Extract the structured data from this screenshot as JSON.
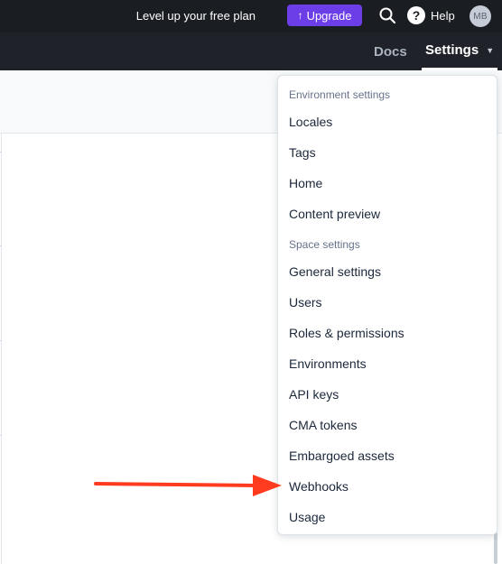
{
  "topbar": {
    "promo_text": "Level up your free plan",
    "upgrade_label": "Upgrade",
    "help_label": "Help",
    "avatar_initials": "MB"
  },
  "nav": {
    "docs_label": "Docs",
    "settings_label": "Settings"
  },
  "menu": {
    "environment_heading": "Environment settings",
    "environment_items": [
      "Locales",
      "Tags",
      "Home",
      "Content preview"
    ],
    "space_heading": "Space settings",
    "space_items": [
      "General settings",
      "Users",
      "Roles & permissions",
      "Environments",
      "API keys",
      "CMA tokens",
      "Embargoed assets",
      "Webhooks",
      "Usage"
    ]
  },
  "colors": {
    "topbar_bg": "#1a1d22",
    "navbar_bg": "#1f2329",
    "upgrade_purple": "#6c3ee8",
    "annotation_red": "#ff3b1f"
  }
}
